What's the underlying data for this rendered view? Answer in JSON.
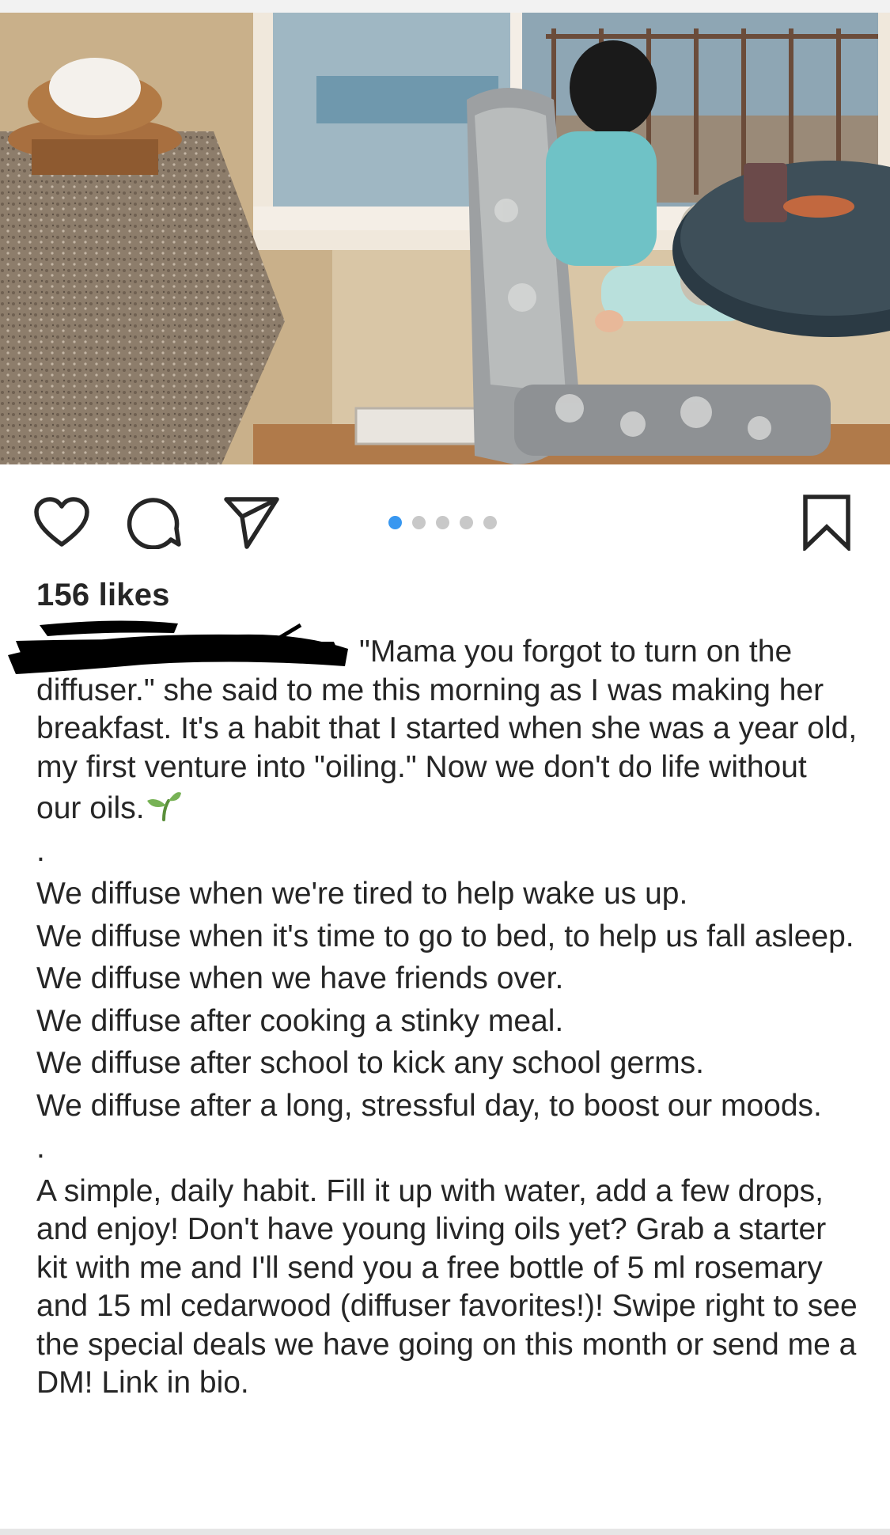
{
  "post": {
    "likes_text": "156 likes",
    "carousel": {
      "count": 5,
      "active_index": 0
    },
    "caption": {
      "username_redacted": true,
      "line_1": "\"Mama you forgot to turn on the",
      "para_1_rest": "diffuser.\" she said to me this morning as I was making her breakfast. It's a habit that I started when she was a year old, my first venture into \"oiling.\" Now we don't do life without our oils.",
      "sep_1": ".",
      "list": [
        "We diffuse when we're tired to help wake us up.",
        "We diffuse when it's time to go to bed, to help us fall asleep.",
        "We diffuse when we have friends over.",
        "We diffuse after cooking a stinky meal.",
        "We diffuse after school to kick any school germs.",
        "We diffuse after a long, stressful day, to boost our moods."
      ],
      "sep_2": ".",
      "para_2": "A simple, daily habit. Fill it up with water, add a few drops, and enjoy! Don't have young living oils yet? Grab a starter kit with me and I'll send you a free bottle of 5 ml rosemary and 15 ml cedarwood (diffuser favorites!)! Swipe right to see the special deals we have going on this month or send me a DM! Link in bio."
    }
  },
  "icons": {
    "like": "heart-icon",
    "comment": "comment-bubble-icon",
    "share": "paper-plane-icon",
    "save": "bookmark-icon",
    "emoji": "seedling-emoji"
  },
  "colors": {
    "text": "#262626",
    "dot_active": "#3897f0",
    "dot_inactive": "#c8c8c8",
    "redaction": "#000000",
    "emoji_green": "#77b255"
  }
}
